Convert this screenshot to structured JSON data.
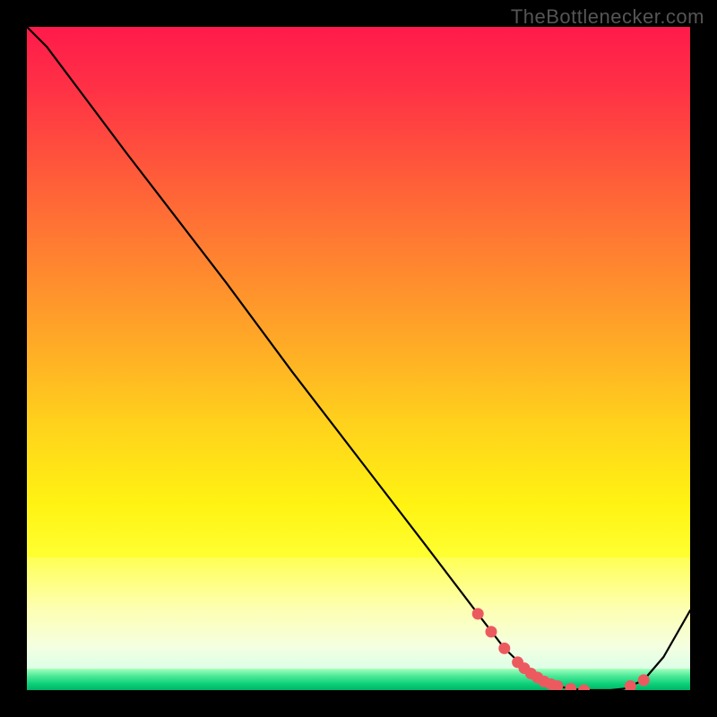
{
  "watermark": "TheBottlenecker.com",
  "chart_data": {
    "type": "line",
    "x": [
      0,
      3,
      6,
      9,
      12,
      15,
      20,
      30,
      40,
      50,
      60,
      68,
      72,
      76,
      78,
      80,
      82,
      84,
      86,
      88,
      90,
      93,
      96,
      100
    ],
    "values": [
      100,
      97,
      93,
      89,
      85,
      81,
      74.5,
      61.5,
      48,
      35,
      22,
      11.5,
      6.3,
      2.5,
      1.3,
      0.6,
      0.2,
      0,
      0,
      0,
      0.2,
      1.5,
      5,
      12
    ],
    "marker_points": {
      "x": [
        68,
        70,
        72,
        74,
        75,
        76,
        77,
        78,
        79,
        80,
        82,
        84,
        91,
        93
      ],
      "y": [
        11.5,
        8.8,
        6.3,
        4.2,
        3.3,
        2.5,
        1.9,
        1.3,
        0.9,
        0.6,
        0.2,
        0,
        0.6,
        1.5
      ]
    },
    "title": "",
    "xlabel": "",
    "ylabel": "",
    "xlim": [
      0,
      100
    ],
    "ylim": [
      0,
      100
    ],
    "green_band_frac": [
      0.968,
      1.0
    ],
    "pale_band_frac": [
      0.8,
      0.968
    ]
  }
}
